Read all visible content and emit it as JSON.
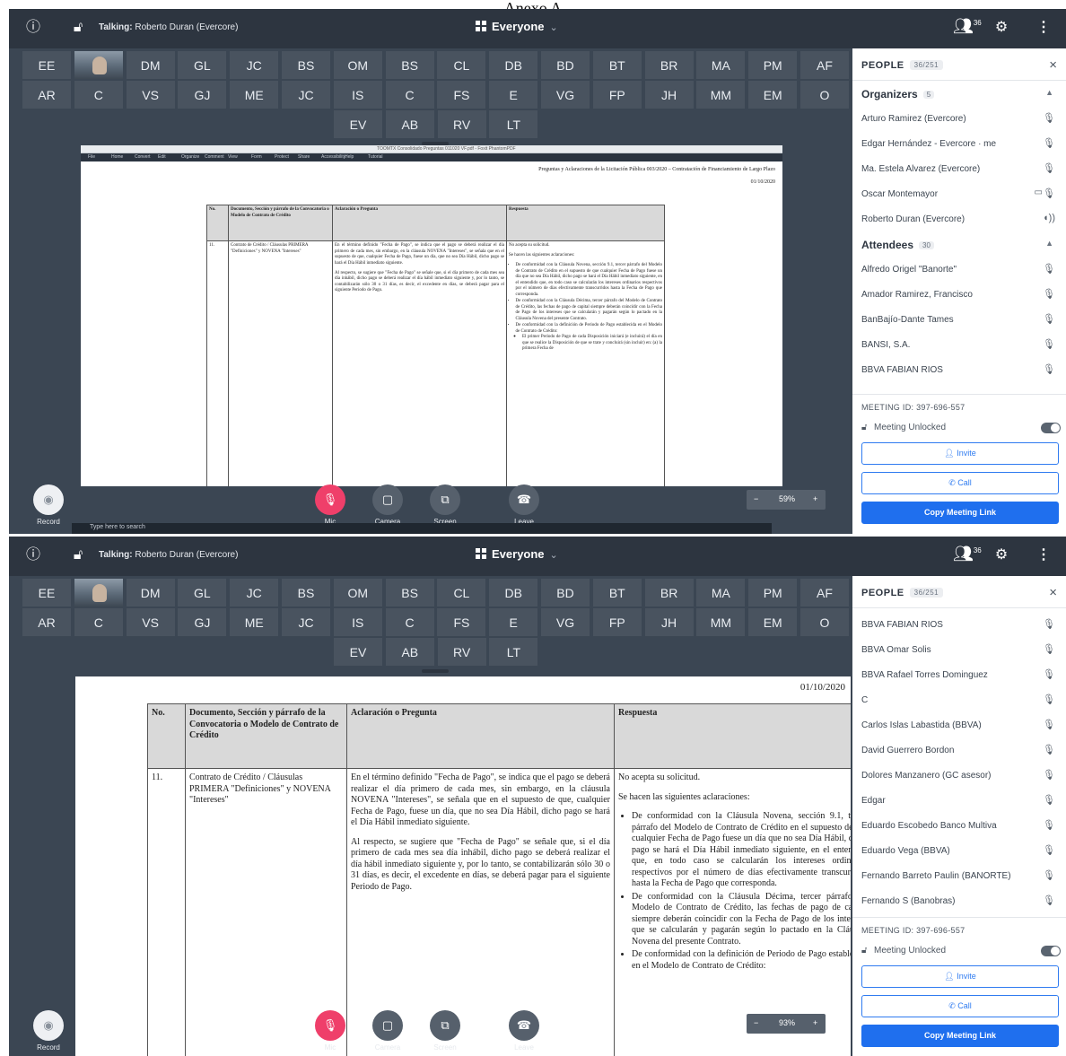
{
  "page_heading": "Anexo A",
  "meeting": {
    "talking_label": "Talking:",
    "talking_name": "Roberto Duran (Evercore)",
    "audience": "Everyone",
    "participant_badge": "36",
    "tiles_row1": [
      "EE",
      "",
      "DM",
      "GL",
      "JC",
      "BS",
      "OM",
      "BS",
      "CL",
      "DB",
      "BD",
      "BT",
      "BR",
      "MA",
      "PM",
      "AF"
    ],
    "tiles_row2": [
      "AR",
      "C",
      "VS",
      "GJ",
      "ME",
      "JC",
      "IS",
      "C",
      "FS",
      "E",
      "VG",
      "FP",
      "JH",
      "MM",
      "EM",
      "O"
    ],
    "tiles_row3": [
      "EV",
      "AB",
      "RV",
      "LT"
    ]
  },
  "controls": {
    "record": "Record",
    "mic": "Mic",
    "camera": "Camera",
    "screen": "Screen",
    "leave": "Leave",
    "zoom_top": "59%",
    "zoom_bottom": "93%",
    "taskbar_search": "Type here to search"
  },
  "sidebar": {
    "title": "PEOPLE",
    "count": "36/251",
    "organizers_label": "Organizers",
    "organizers_count": "5",
    "organizers": [
      "Arturo Ramirez (Evercore)",
      "Edgar Hernández - Evercore · me",
      "Ma. Estela Alvarez (Evercore)",
      "Oscar Montemayor",
      "Roberto Duran (Evercore)"
    ],
    "attendees_label": "Attendees",
    "attendees_count": "30",
    "attendees_top": [
      "Alfredo Origel \"Banorte\"",
      "Amador Ramirez, Francisco",
      "BanBajío-Dante Tames",
      "BANSI, S.A.",
      "BBVA FABIAN RIOS"
    ],
    "attendees_bottom": [
      "BBVA FABIAN RIOS",
      "BBVA Omar Solis",
      "BBVA Rafael Torres Dominguez",
      "C",
      "Carlos Islas Labastida (BBVA)",
      "David Guerrero Bordon",
      "Dolores Manzanero (GC asesor)",
      "Edgar",
      "Eduardo Escobedo Banco Multiva",
      "Eduardo Vega (BBVA)",
      "Fernando Barreto Paulin (BANORTE)",
      "Fernando S (Banobras)"
    ],
    "meeting_id": "MEETING ID: 397-696-557",
    "meeting_unlocked": "Meeting Unlocked",
    "invite": "Invite",
    "call": "Call",
    "copy_link": "Copy Meeting Link"
  },
  "viewer": {
    "title": "TOOMTX Consolidado Preguntas 011020 VF.pdf - Foxit PhantomPDF",
    "menu": [
      "File",
      "Home",
      "Convert",
      "Edit",
      "Organize",
      "Comment",
      "View",
      "Form",
      "Protect",
      "Share",
      "Accessibility",
      "Help",
      "Tutorial"
    ]
  },
  "document": {
    "heading": "Preguntas y Aclaraciones de la Licitación Pública 003/2020 – Contratación de Financiamiento de Largo Plazo",
    "date": "01/10/2020",
    "col_no": "No.",
    "col_doc": "Documento, Sección y párrafo de la Convocatoria o Modelo de Contrato de Crédito",
    "col_q": "Aclaración o Pregunta",
    "col_a": "Respuesta",
    "row_no": "11.",
    "row_doc": "Contrato de Crédito / Cláusulas PRIMERA \"Definiciones\" y NOVENA \"Intereses\"",
    "row_q1": "En el término definido \"Fecha de Pago\", se indica que el pago se deberá realizar el día primero de cada mes, sin embargo, en la cláusula NOVENA \"Intereses\", se señala que en el supuesto de que, cualquier Fecha de Pago, fuese un día, que no sea Día Hábil, dicho pago se hará el Día Hábil inmediato siguiente.",
    "row_q2": "Al respecto, se sugiere que \"Fecha de Pago\" se señale que, si el día primero de cada mes sea día inhábil, dicho pago se deberá realizar el día hábil inmediato siguiente y, por lo tanto, se contabilizarán sólo 30 o 31 días, es decir, el excedente en días, se deberá pagar para el siguiente Periodo de Pago.",
    "row_a1": "No acepta su solicitud.",
    "row_a2": "Se hacen las siguientes aclaraciones:",
    "row_a_b1": "De conformidad con la Cláusula Novena, sección 9.1, tercer párrafo del Modelo de Contrato de Crédito en el supuesto de que cualquier Fecha de Pago fuese un día que no sea Día Hábil, dicho pago se hará el Día Hábil inmediato siguiente, en el entendido que, en todo caso se calcularán los intereses ordinarios respectivos por el número de días efectivamente transcurridos hasta la Fecha de Pago que corresponda.",
    "row_a_b2": "De conformidad con la Cláusula Décima, tercer párrafo del Modelo de Contrato de Crédito, las fechas de pago de capital siempre deberán coincidir con la Fecha de Pago de los intereses que se calcularán y pagarán según lo pactado en la Cláusula Novena del presente Contrato.",
    "row_a_b3": "De conformidad con la definición de Periodo de Pago establecida en el Modelo de Contrato de Crédito:",
    "row_a_sub1": "El primer Periodo de Pago de cada Disposición iniciará (e incluirá) el día en que se realice la Disposición de que se trate y concluirá (sin incluir) en: (a) la primera Fecha de"
  }
}
